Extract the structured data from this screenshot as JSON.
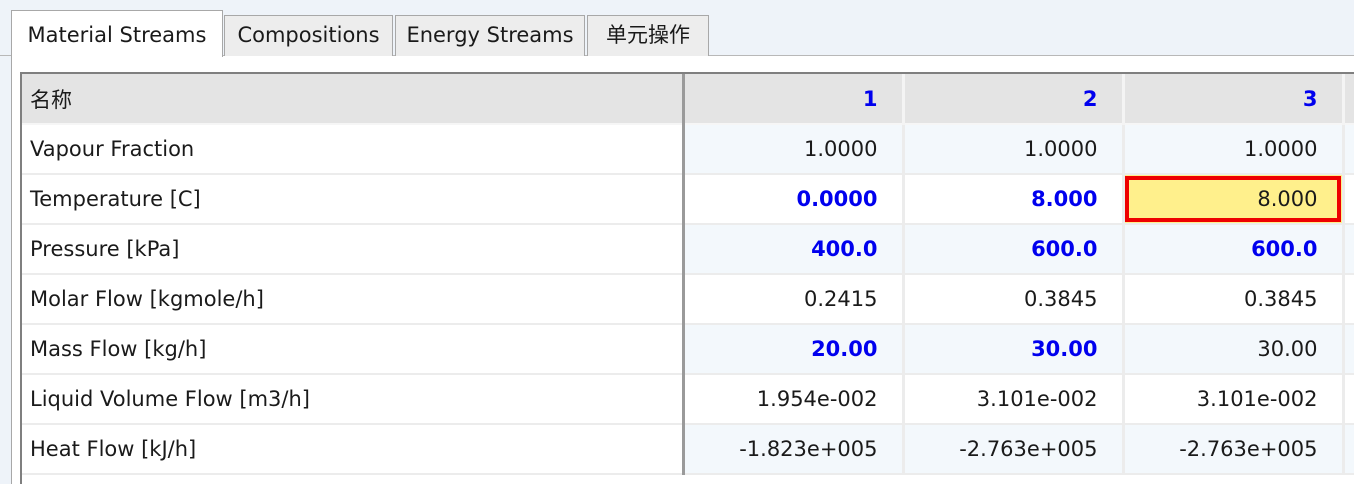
{
  "tabs": [
    {
      "label": "Material Streams",
      "active": true
    },
    {
      "label": "Compositions",
      "active": false
    },
    {
      "label": "Energy Streams",
      "active": false
    },
    {
      "label": "单元操作",
      "active": false
    }
  ],
  "table": {
    "name_header": "名称",
    "columns": [
      "1",
      "2",
      "3"
    ],
    "rows": [
      {
        "label": "Vapour Fraction",
        "values": [
          "1.0000",
          "1.0000",
          "1.0000"
        ]
      },
      {
        "label": "Temperature [C]",
        "values": [
          "0.0000",
          "8.000",
          "8.000"
        ]
      },
      {
        "label": "Pressure [kPa]",
        "values": [
          "400.0",
          "600.0",
          "600.0"
        ]
      },
      {
        "label": "Molar Flow [kgmole/h]",
        "values": [
          "0.2415",
          "0.3845",
          "0.3845"
        ]
      },
      {
        "label": "Mass Flow [kg/h]",
        "values": [
          "20.00",
          "30.00",
          "30.00"
        ]
      },
      {
        "label": "Liquid Volume Flow [m3/h]",
        "values": [
          "1.954e-002",
          "3.101e-002",
          "3.101e-002"
        ]
      },
      {
        "label": "Heat Flow [kJ/h]",
        "values": [
          "-1.823e+005",
          "-2.763e+005",
          "-2.763e+005"
        ]
      }
    ]
  },
  "colors": {
    "specified_value": "#0000ee",
    "selection_fill": "#fff08c",
    "selection_border": "#ee0000"
  }
}
